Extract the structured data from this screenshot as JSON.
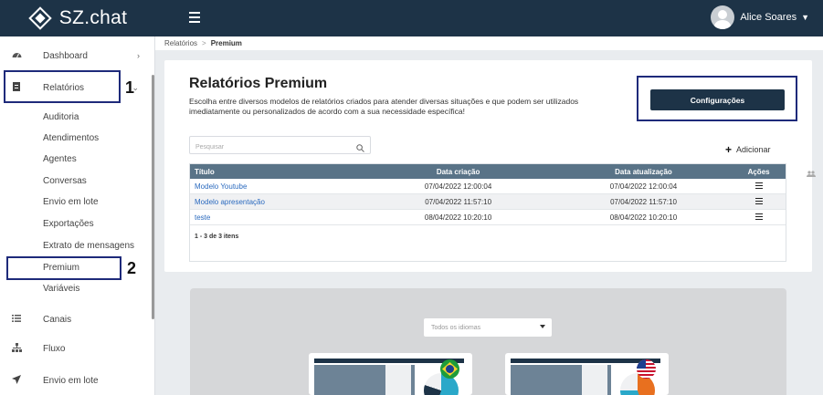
{
  "app": {
    "brand_name": "SZ.chat"
  },
  "user": {
    "name": "Alice Soares"
  },
  "sidebar": {
    "items": [
      {
        "label": "Dashboard",
        "icon": "dashboard-icon"
      },
      {
        "label": "Relatórios",
        "icon": "report-icon"
      },
      {
        "label": "Canais",
        "icon": "list-icon"
      },
      {
        "label": "Fluxo",
        "icon": "sitemap-icon"
      },
      {
        "label": "Envio em lote",
        "icon": "send-icon"
      }
    ],
    "relatorios_sub": [
      "Auditoria",
      "Atendimentos",
      "Agentes",
      "Conversas",
      "Envio em lote",
      "Exportações",
      "Extrato de mensagens",
      "Premium",
      "Variáveis"
    ]
  },
  "annotations": {
    "box1": "1",
    "box2": "2"
  },
  "breadcrumb": {
    "parent": "Relatórios",
    "separator": ">",
    "current": "Premium"
  },
  "page": {
    "title": "Relatórios Premium",
    "description": "Escolha entre diversos modelos de relatórios criados para atender diversas situações e que podem ser utilizados imediatamente ou personalizados de acordo com a sua necessidade específica!",
    "config_button": "Configurações",
    "search_placeholder": "Pesquisar",
    "add_button": "Adicionar"
  },
  "table": {
    "headers": [
      "Título",
      "Data criação",
      "Data atualização",
      "Ações"
    ],
    "rows": [
      {
        "title": "Modelo Youtube",
        "created": "07/04/2022 12:00:04",
        "updated": "07/04/2022 12:00:04"
      },
      {
        "title": "Modelo apresentação",
        "created": "07/04/2022 11:57:10",
        "updated": "07/04/2022 11:57:10"
      },
      {
        "title": "teste",
        "created": "08/04/2022 10:20:10",
        "updated": "08/04/2022 10:20:10"
      }
    ],
    "pager": "1 - 3 de 3 itens"
  },
  "gallery": {
    "language_select": "Todos os idiomas"
  },
  "colors": {
    "navbar": "#1d3347",
    "table_header": "#597387",
    "link": "#2c6bbf",
    "annotation": "#1e2a7a"
  }
}
